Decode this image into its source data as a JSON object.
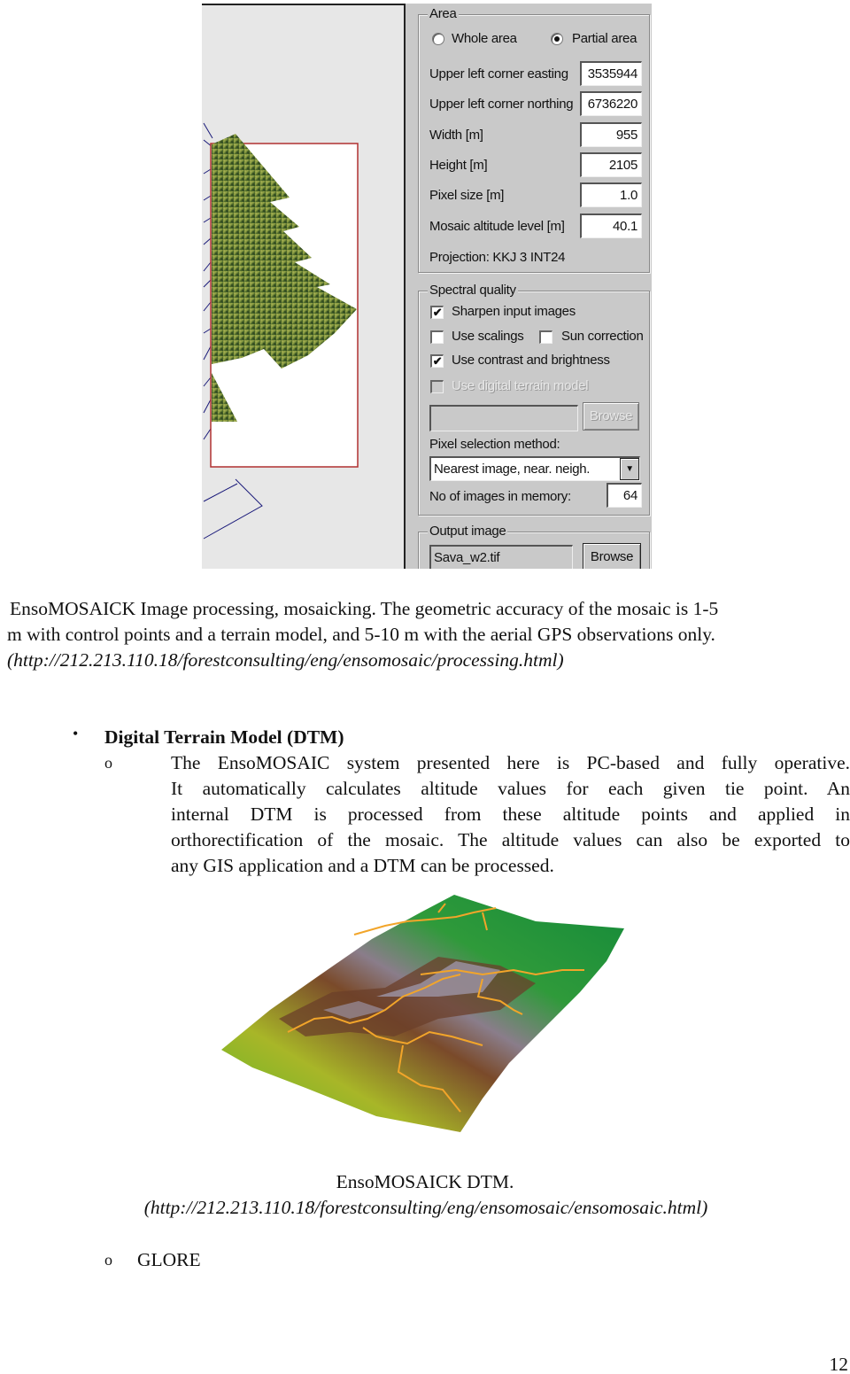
{
  "screenshot": {
    "area_group": {
      "title": "Area",
      "radio_whole": {
        "label": "Whole area",
        "selected": false
      },
      "radio_partial": {
        "label": "Partial area",
        "selected": true
      },
      "fields": [
        {
          "label": "Upper left corner easting",
          "value": "3535944"
        },
        {
          "label": "Upper left corner northing",
          "value": "6736220"
        },
        {
          "label": "Width [m]",
          "value": "955"
        },
        {
          "label": "Height [m]",
          "value": "2105"
        },
        {
          "label": "Pixel size [m]",
          "value": "1.0"
        },
        {
          "label": "Mosaic altitude level [m]",
          "value": "40.1"
        }
      ],
      "projection": "Projection: KKJ 3 INT24"
    },
    "spectral_group": {
      "title": "Spectral quality",
      "sharpen": {
        "label": "Sharpen input images",
        "checked": true
      },
      "scalings": {
        "label": "Use scalings",
        "checked": false
      },
      "sun": {
        "label": "Sun correction",
        "checked": false
      },
      "contrast": {
        "label": "Use contrast and brightness",
        "checked": true
      },
      "dtm": {
        "label": "Use digital terrain model",
        "checked": false,
        "disabled": true
      },
      "dtm_path_value": "",
      "browse_label": "Browse",
      "pixel_method_label": "Pixel selection method:",
      "pixel_method_value": "Nearest image, near. neigh.",
      "images_memory_label": "No of images in memory:",
      "images_memory_value": "64"
    },
    "output_group": {
      "title": "Output image",
      "file_value": "Sava_w2.tif",
      "browse_label": "Browse"
    },
    "check_mark": "✔",
    "dropdown_arrow": "▼"
  },
  "caption1": {
    "line1": "EnsoMOSAICK Image processing, mosaicking. The geometric accuracy of the mosaic is 1-5",
    "line2": "m with control points and a terrain model, and 5-10 m with the aerial GPS observations only.",
    "url": "(http://212.213.110.18/forestconsulting/eng/ensomosaic/processing.html)"
  },
  "section": {
    "bullet": "•",
    "heading": "Digital Terrain Model (DTM)",
    "sub_bullet": "o",
    "lines": [
      "The EnsoMOSAIC system presented here is PC-based and fully operative.",
      "It automatically calculates altitude values for each given tie point. An",
      "internal DTM is processed from these altitude points and applied in",
      "orthorectification of the mosaic. The altitude values can also be exported to",
      "any GIS application and a DTM can be processed."
    ]
  },
  "caption2": {
    "title": "EnsoMOSAICK DTM.",
    "url": "(http://212.213.110.18/forestconsulting/eng/ensomosaic/ensomosaic.html)"
  },
  "next_item": {
    "bullet": "o",
    "label": "GLORE"
  },
  "page_number": "12"
}
